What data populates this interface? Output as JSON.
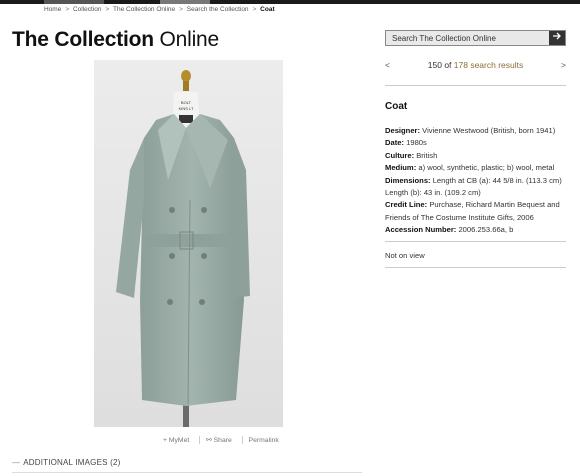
{
  "breadcrumb": {
    "items": [
      "Home",
      "Collection",
      "The Collection Online",
      "Search the Collection"
    ],
    "current": "Coat"
  },
  "site_title": {
    "bold": "The Collection",
    "light": "Online"
  },
  "search": {
    "placeholder": "Search The Collection Online",
    "button_icon": "arrow-right-icon"
  },
  "result_nav": {
    "prev": "<",
    "next": ">",
    "position": "150",
    "of": "of",
    "total_link": "178 search results"
  },
  "object": {
    "title": "Coat",
    "fields": [
      {
        "label": "Designer:",
        "value": "Vivienne Westwood (British, born 1941)"
      },
      {
        "label": "Date:",
        "value": "1980s"
      },
      {
        "label": "Culture:",
        "value": "British"
      },
      {
        "label": "Medium:",
        "value": "a) wool, synthetic, plastic; b) wool, metal"
      },
      {
        "label": "Dimensions:",
        "value": "Length at CB (a): 44 5/8 in. (113.3 cm) Length (b): 43 in. (109.2 cm)"
      },
      {
        "label": "Credit Line:",
        "value": "Purchase, Richard Martin Bequest and Friends of The Costume Institute Gifts, 2006"
      },
      {
        "label": "Accession Number:",
        "value": "2006.253.66a, b"
      }
    ],
    "on_view": "Not on view"
  },
  "image_actions": {
    "mymet": "+ MyMet",
    "share": "Share",
    "permalink": "Permalink"
  },
  "additional_images": {
    "label": "ADDITIONAL IMAGES (2)"
  },
  "colors": {
    "coat": "#9aaca6",
    "link": "#8a6d3b",
    "background": "#e6e6e6"
  }
}
